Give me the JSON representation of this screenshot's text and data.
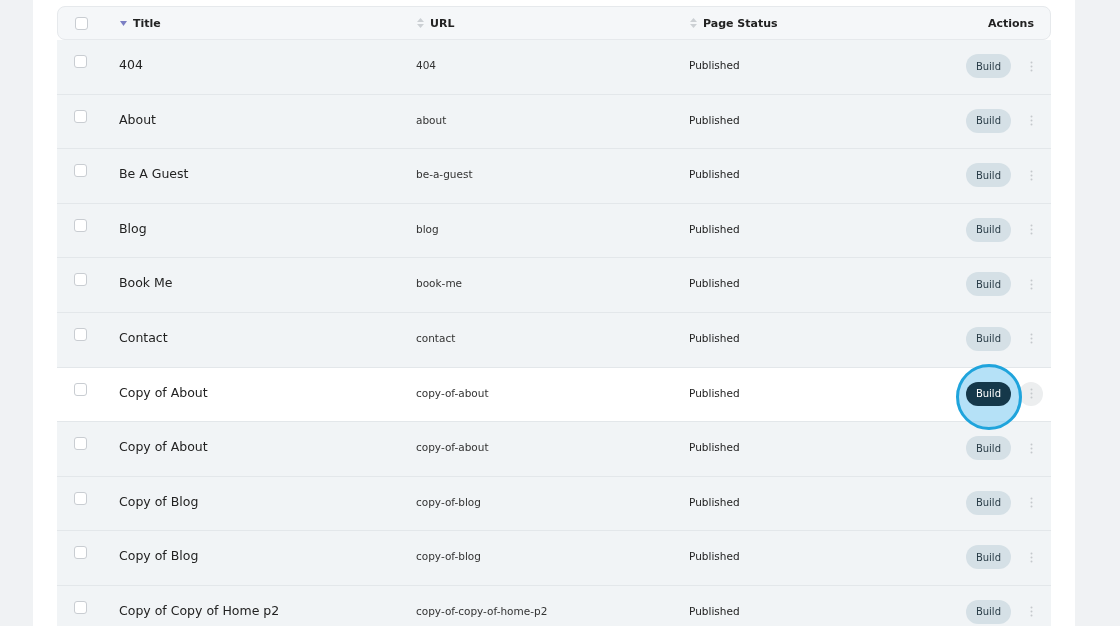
{
  "table": {
    "columns": [
      {
        "kind": "check",
        "checked": false
      },
      {
        "kind": "sort",
        "label": "Title",
        "sorted": true
      },
      {
        "kind": "sort",
        "label": "URL",
        "sorted": false
      },
      {
        "kind": "sort",
        "label": "Page Status",
        "sorted": false
      },
      {
        "kind": "plain",
        "label": "Actions"
      }
    ],
    "rows": [
      {
        "title": "404",
        "url": "404",
        "status": "Published",
        "action": "Build",
        "checked": false,
        "hovered": false
      },
      {
        "title": "About",
        "url": "about",
        "status": "Published",
        "action": "Build",
        "checked": false,
        "hovered": false
      },
      {
        "title": "Be A Guest",
        "url": "be-a-guest",
        "status": "Published",
        "action": "Build",
        "checked": false,
        "hovered": false
      },
      {
        "title": "Blog",
        "url": "blog",
        "status": "Published",
        "action": "Build",
        "checked": false,
        "hovered": false
      },
      {
        "title": "Book Me",
        "url": "book-me",
        "status": "Published",
        "action": "Build",
        "checked": false,
        "hovered": false
      },
      {
        "title": "Contact",
        "url": "contact",
        "status": "Published",
        "action": "Build",
        "checked": false,
        "hovered": false
      },
      {
        "title": "Copy of About",
        "url": "copy-of-about",
        "status": "Published",
        "action": "Build",
        "checked": false,
        "hovered": true
      },
      {
        "title": "Copy of About",
        "url": "copy-of-about",
        "status": "Published",
        "action": "Build",
        "checked": false,
        "hovered": false
      },
      {
        "title": "Copy of Blog",
        "url": "copy-of-blog",
        "status": "Published",
        "action": "Build",
        "checked": false,
        "hovered": false
      },
      {
        "title": "Copy of Blog",
        "url": "copy-of-blog",
        "status": "Published",
        "action": "Build",
        "checked": false,
        "hovered": false
      },
      {
        "title": "Copy of Copy of Home p2",
        "url": "copy-of-copy-of-home-p2",
        "status": "Published",
        "action": "Build",
        "checked": false,
        "hovered": false
      }
    ]
  }
}
